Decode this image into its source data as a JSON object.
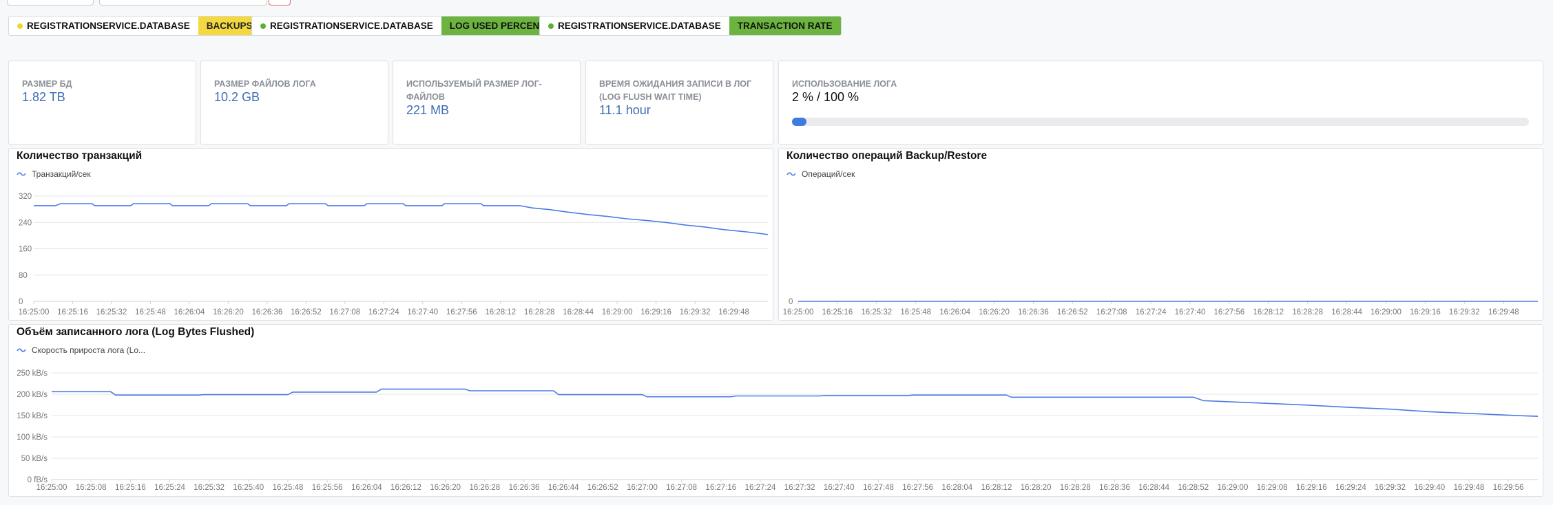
{
  "filters": [
    {
      "name": "REGISTRATIONSERVICE.DATABASE",
      "tag": "BACKUPS",
      "dot_color": "#f2d33b",
      "tag_color": "#f3d93f",
      "tag_text_color": "#222222"
    },
    {
      "name": "REGISTRATIONSERVICE.DATABASE",
      "tag": "LOG USED PERCENT",
      "dot_color": "#5ab032",
      "tag_color": "#6cb33f",
      "tag_text_color": "#111111"
    },
    {
      "name": "REGISTRATIONSERVICE.DATABASE",
      "tag": "TRANSACTION RATE",
      "dot_color": "#5ab032",
      "tag_color": "#6cb33f",
      "tag_text_color": "#111111"
    }
  ],
  "stats": [
    {
      "label": "Размер БД",
      "value": "1.82 TB"
    },
    {
      "label": "Размер файлов лога",
      "value": "10.2 GB"
    },
    {
      "label": "Используемый размер лог-файлов",
      "value": "221 MB"
    },
    {
      "label": "Время ожидания записи в лог (Log Flush Wait Time)",
      "value": "11.1 hour"
    }
  ],
  "gauge": {
    "label": "Использование лога",
    "value_text": "2 % / 100 %",
    "percent": 2
  },
  "charts": {
    "transactions": {
      "title": "Количество транзакций",
      "legend": "Транзакций/сек",
      "chart_data": {
        "type": "line",
        "ylim": [
          0,
          320
        ],
        "y_ticks": [
          "0",
          "80",
          "160",
          "240",
          "320"
        ],
        "x_ticks": [
          "16:25:00",
          "16:25:16",
          "16:25:32",
          "16:25:48",
          "16:26:04",
          "16:26:20",
          "16:26:36",
          "16:26:52",
          "16:27:08",
          "16:27:24",
          "16:27:40",
          "16:27:56",
          "16:28:12",
          "16:28:28",
          "16:28:44",
          "16:29:00",
          "16:29:16",
          "16:29:32",
          "16:29:48"
        ],
        "x_seconds_range": [
          0,
          302
        ],
        "series": [
          {
            "name": "Транзакций/сек",
            "color": "#4b7be5",
            "points": [
              [
                0,
                291
              ],
              [
                9,
                291
              ],
              [
                11,
                297
              ],
              [
                24,
                297
              ],
              [
                25,
                291
              ],
              [
                40,
                291
              ],
              [
                41,
                297
              ],
              [
                56,
                297
              ],
              [
                57,
                291
              ],
              [
                72,
                291
              ],
              [
                73,
                297
              ],
              [
                88,
                297
              ],
              [
                89,
                291
              ],
              [
                104,
                291
              ],
              [
                105,
                297
              ],
              [
                120,
                297
              ],
              [
                121,
                291
              ],
              [
                136,
                291
              ],
              [
                137,
                297
              ],
              [
                152,
                297
              ],
              [
                153,
                291
              ],
              [
                168,
                291
              ],
              [
                169,
                297
              ],
              [
                184,
                297
              ],
              [
                185,
                291
              ],
              [
                200,
                291
              ],
              [
                205,
                284
              ],
              [
                212,
                279
              ],
              [
                220,
                271
              ],
              [
                228,
                264
              ],
              [
                236,
                258
              ],
              [
                244,
                251
              ],
              [
                252,
                246
              ],
              [
                260,
                240
              ],
              [
                268,
                232
              ],
              [
                276,
                226
              ],
              [
                284,
                218
              ],
              [
                292,
                212
              ],
              [
                298,
                207
              ],
              [
                302,
                203
              ]
            ]
          }
        ]
      }
    },
    "backup": {
      "title": "Количество операций Backup/Restore",
      "legend": "Операций/сек",
      "chart_data": {
        "type": "line",
        "ylim": [
          0,
          1
        ],
        "y_ticks": [
          "0"
        ],
        "x_ticks": [
          "16:25:00",
          "16:25:16",
          "16:25:32",
          "16:25:48",
          "16:26:04",
          "16:26:20",
          "16:26:36",
          "16:26:52",
          "16:27:08",
          "16:27:24",
          "16:27:40",
          "16:27:56",
          "16:28:12",
          "16:28:28",
          "16:28:44",
          "16:29:00",
          "16:29:16",
          "16:29:32",
          "16:29:48"
        ],
        "x_seconds_range": [
          0,
          302
        ],
        "series": [
          {
            "name": "Операций/сек",
            "color": "#4b7be5",
            "points": [
              [
                0,
                0
              ],
              [
                302,
                0
              ]
            ]
          }
        ]
      }
    },
    "log_flushed": {
      "title": "Объём записанного лога (Log Bytes Flushed)",
      "legend": "Скорость прироста лога (Lo...",
      "chart_data": {
        "type": "line",
        "ylim": [
          0,
          250
        ],
        "y_ticks": [
          "0 fB/s",
          "50 kB/s",
          "100 kB/s",
          "150 kB/s",
          "200 kB/s",
          "250 kB/s"
        ],
        "x_ticks": [
          "16:25:00",
          "16:25:08",
          "16:25:16",
          "16:25:24",
          "16:25:32",
          "16:25:40",
          "16:25:48",
          "16:25:56",
          "16:26:04",
          "16:26:12",
          "16:26:20",
          "16:26:28",
          "16:26:36",
          "16:26:44",
          "16:26:52",
          "16:27:00",
          "16:27:08",
          "16:27:16",
          "16:27:24",
          "16:27:32",
          "16:27:40",
          "16:27:48",
          "16:27:56",
          "16:28:04",
          "16:28:12",
          "16:28:20",
          "16:28:28",
          "16:28:36",
          "16:28:44",
          "16:28:52",
          "16:29:00",
          "16:29:08",
          "16:29:16",
          "16:29:24",
          "16:29:32",
          "16:29:40",
          "16:29:48",
          "16:29:56"
        ],
        "x_seconds_range": [
          0,
          302
        ],
        "series": [
          {
            "name": "Скорость прироста лога (Lo...",
            "color": "#4b7be5",
            "points": [
              [
                0,
                206
              ],
              [
                12,
                206
              ],
              [
                13,
                198
              ],
              [
                30,
                198
              ],
              [
                31,
                199
              ],
              [
                48,
                199
              ],
              [
                49,
                205
              ],
              [
                66,
                205
              ],
              [
                67,
                212
              ],
              [
                84,
                212
              ],
              [
                85,
                208
              ],
              [
                102,
                208
              ],
              [
                103,
                199
              ],
              [
                120,
                199
              ],
              [
                121,
                194
              ],
              [
                138,
                194
              ],
              [
                139,
                196
              ],
              [
                156,
                196
              ],
              [
                157,
                197
              ],
              [
                174,
                197
              ],
              [
                175,
                198
              ],
              [
                194,
                198
              ],
              [
                195,
                193
              ],
              [
                232,
                193
              ],
              [
                234,
                185
              ],
              [
                240,
                182
              ],
              [
                248,
                178
              ],
              [
                256,
                174
              ],
              [
                264,
                169
              ],
              [
                272,
                165
              ],
              [
                280,
                159
              ],
              [
                288,
                155
              ],
              [
                296,
                151
              ],
              [
                302,
                148
              ]
            ]
          }
        ]
      }
    }
  }
}
